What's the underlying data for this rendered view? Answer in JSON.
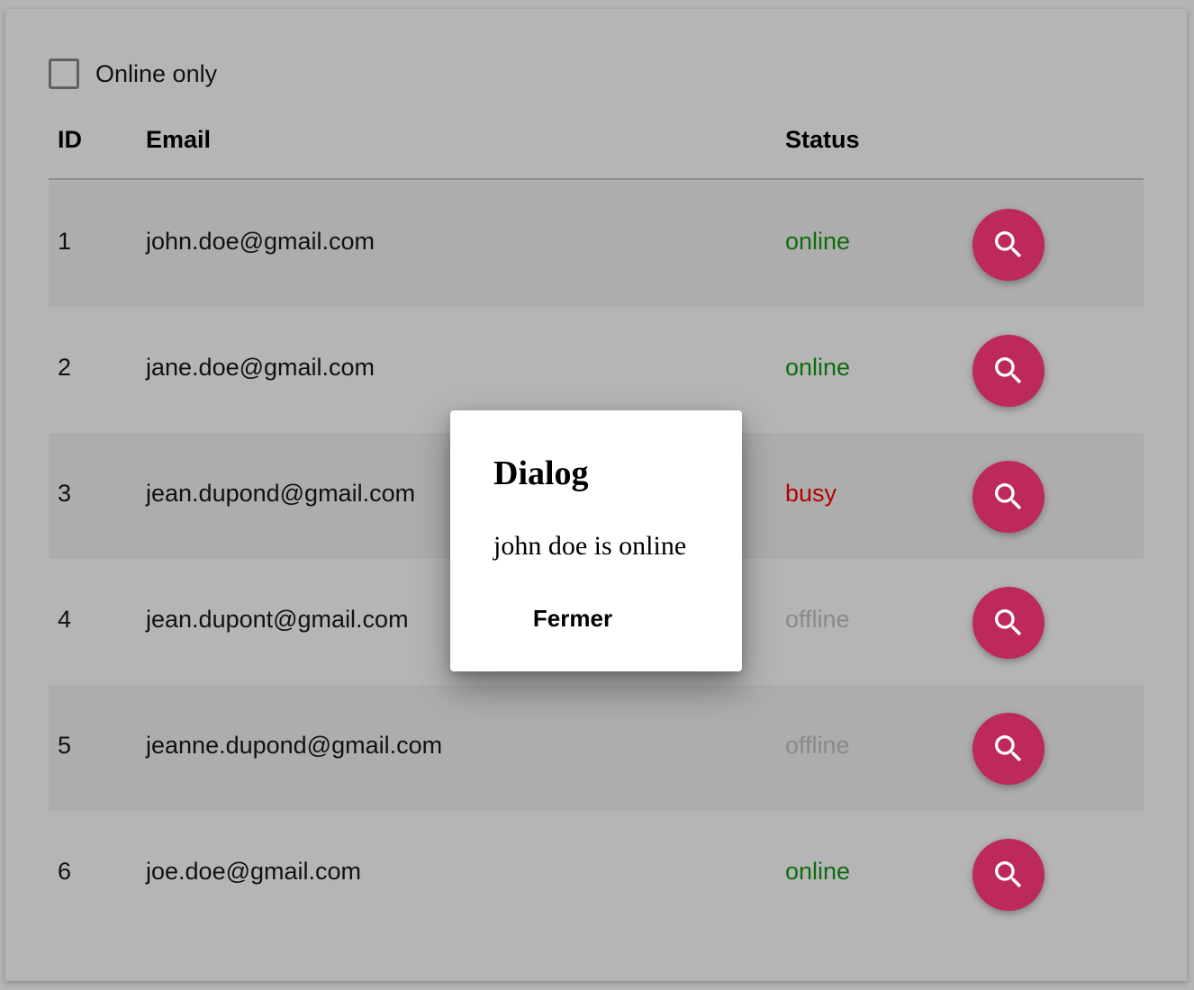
{
  "filter": {
    "label": "Online only",
    "checked": false
  },
  "table": {
    "headers": {
      "id": "ID",
      "email": "Email",
      "status": "Status"
    },
    "rows": [
      {
        "id": "1",
        "email": "john.doe@gmail.com",
        "status": "online"
      },
      {
        "id": "2",
        "email": "jane.doe@gmail.com",
        "status": "online"
      },
      {
        "id": "3",
        "email": "jean.dupond@gmail.com",
        "status": "busy"
      },
      {
        "id": "4",
        "email": "jean.dupont@gmail.com",
        "status": "offline"
      },
      {
        "id": "5",
        "email": "jeanne.dupond@gmail.com",
        "status": "offline"
      },
      {
        "id": "6",
        "email": "joe.doe@gmail.com",
        "status": "online"
      }
    ],
    "row_action_icon": "search-icon"
  },
  "dialog": {
    "title": "Dialog",
    "message": "john doe is online",
    "close_label": "Fermer"
  },
  "colors": {
    "accent": "#bd2a5a",
    "online": "#0f6b0f",
    "busy": "#b40000",
    "offline": "#8a8a8a"
  }
}
